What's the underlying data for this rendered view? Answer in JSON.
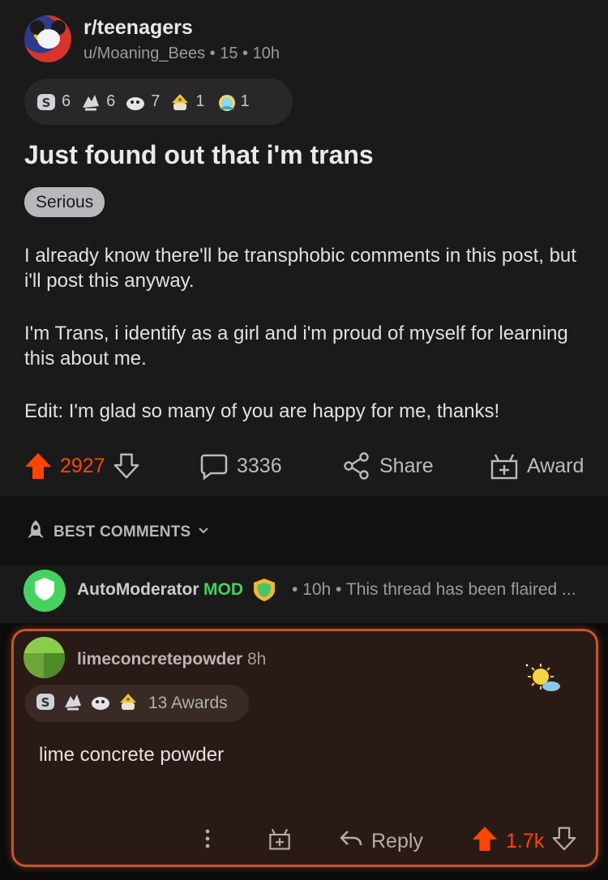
{
  "post": {
    "subreddit": "r/teenagers",
    "meta": "u/Moaning_Bees • 15 • 10h",
    "awards": [
      {
        "icon": "silver-award-icon",
        "count": "6"
      },
      {
        "icon": "wholesome-award-icon",
        "count": "6"
      },
      {
        "icon": "helpful-award-icon",
        "count": "7"
      },
      {
        "icon": "gold-award-icon",
        "count": "1"
      },
      {
        "icon": "ally-award-icon",
        "count": "1"
      }
    ],
    "title": "Just found out that i'm trans",
    "flair": "Serious",
    "body": [
      "I already know there'll be transphobic comments in this post, but i'll post this anyway.",
      "I'm Trans, i identify as a girl and i'm proud of myself for learning this about me.",
      "Edit: I'm glad so many of you are happy for me, thanks!"
    ],
    "actions": {
      "votes": "2927",
      "comments": "3336",
      "share": "Share",
      "award": "Award"
    }
  },
  "sort": {
    "label": "BEST COMMENTS"
  },
  "automod": {
    "name": "AutoModerator",
    "badge": "MOD",
    "meta": "• 10h • This thread has been flaired ..."
  },
  "comment": {
    "username": "limeconcretepowder",
    "time": "8h",
    "awards_label": "13 Awards",
    "body": "lime concrete powder",
    "reply": "Reply",
    "votes": "1.7k"
  },
  "colors": {
    "upvote": "#ff4500",
    "mod_green": "#46d160",
    "highlight_border": "#c4562a"
  }
}
